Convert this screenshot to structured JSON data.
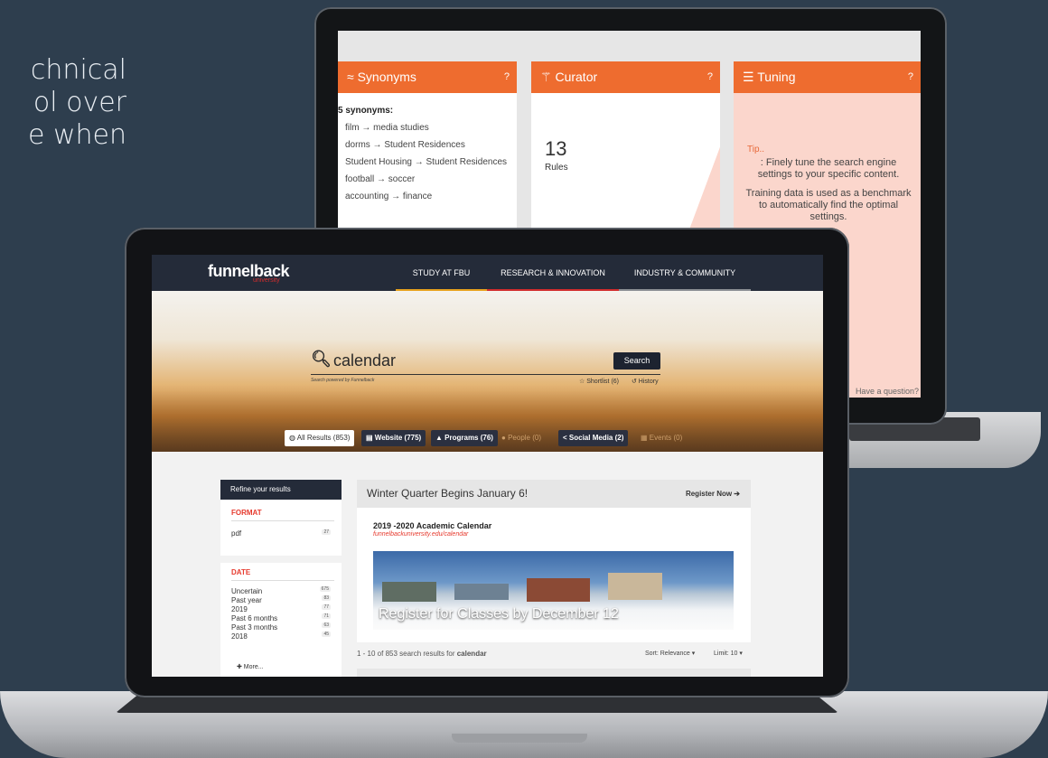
{
  "side_text": [
    "chnical",
    "ol over",
    "e when"
  ],
  "back": {
    "synonyms": {
      "title": "Synonyms",
      "icon": "approx-icon",
      "count_label": "5 synonyms:",
      "rules": [
        "film → media studies",
        "dorms → Student Residences",
        "Student Housing → Student Residences",
        "football → soccer",
        "accounting → finance"
      ]
    },
    "curator": {
      "title": "Curator",
      "icon": "wand-icon",
      "count": "13",
      "label": "Rules"
    },
    "tuning": {
      "title": "Tuning",
      "icon": "sliders-icon",
      "tip_label": "Tip..",
      "text1": ": Finely tune the search engine settings to your specific content.",
      "text2": "Training data is used as a benchmark to automatically find the optimal settings."
    },
    "help_icon": "?",
    "question": "Have a question?"
  },
  "front": {
    "logo": "funnelback",
    "logo_sub": "university",
    "nav": [
      "STUDY AT FBU",
      "RESEARCH & INNOVATION",
      "INDUSTRY & COMMUNITY"
    ],
    "search": {
      "query": "calendar",
      "button": "Search",
      "powered": "Search powered by Funnelback",
      "shortlist": "☆ Shortlist (6)",
      "history": "↺ History"
    },
    "tabs": [
      {
        "label": "All Results (853)",
        "icon": "globe-icon"
      },
      {
        "label": "Website (775)",
        "icon": "document-icon"
      },
      {
        "label": "Programs (76)",
        "icon": "graduation-cap-icon"
      },
      {
        "label": "People (0)",
        "icon": "people-icon"
      },
      {
        "label": "Social Media (2)",
        "icon": "share-icon"
      },
      {
        "label": "Events (0)",
        "icon": "calendar-icon"
      }
    ],
    "refine": {
      "title": "Refine your results",
      "format_title": "FORMAT",
      "format_items": [
        {
          "label": "pdf",
          "count": "27"
        }
      ],
      "date_title": "DATE",
      "date_items": [
        {
          "label": "Uncertain",
          "count": "675"
        },
        {
          "label": "Past year",
          "count": "83"
        },
        {
          "label": "2019",
          "count": "77"
        },
        {
          "label": "Past 6 months",
          "count": "71"
        },
        {
          "label": "Past 3 months",
          "count": "63"
        },
        {
          "label": "2018",
          "count": "45"
        }
      ],
      "more": "✚ More..."
    },
    "feature": {
      "heading": "Winter Quarter Begins January 6!",
      "register": "Register Now ➔",
      "title": "2019 -2020 Academic Calendar",
      "url": "funnelbackuniversity.edu/calendar",
      "banner_text": "Register for Classes by December 12"
    },
    "results": {
      "prefix": "1 - 10 of 853 search results for ",
      "query": "calendar",
      "sort": "Sort: Relevance ▾",
      "limit": "Limit: 10 ▾"
    }
  }
}
